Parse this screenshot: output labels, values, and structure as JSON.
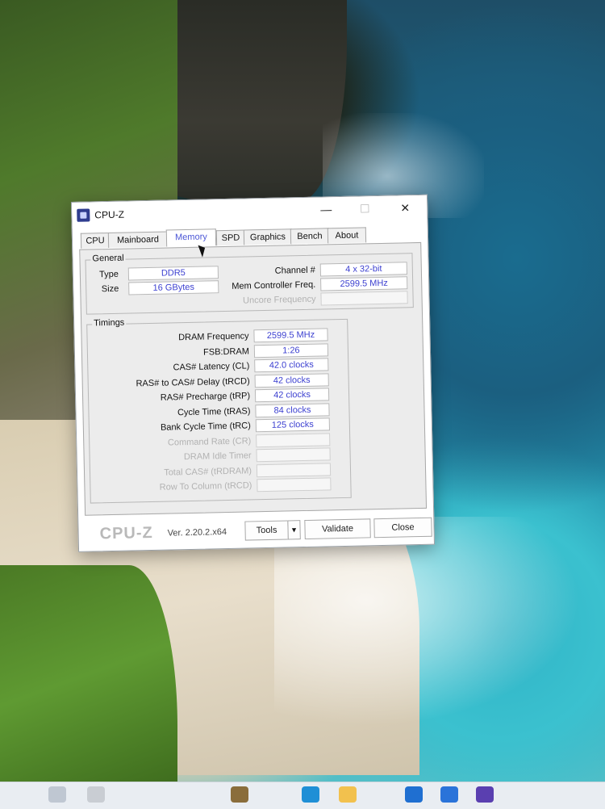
{
  "window": {
    "title": "CPU-Z",
    "minimize_glyph": "—",
    "maximize_glyph": "☐",
    "close_glyph": "✕"
  },
  "tabs": [
    {
      "label": "CPU",
      "active": false
    },
    {
      "label": "Mainboard",
      "active": false
    },
    {
      "label": "Memory",
      "active": true
    },
    {
      "label": "SPD",
      "active": false
    },
    {
      "label": "Graphics",
      "active": false
    },
    {
      "label": "Bench",
      "active": false
    },
    {
      "label": "About",
      "active": false
    }
  ],
  "general": {
    "title": "General",
    "type_label": "Type",
    "type_value": "DDR5",
    "size_label": "Size",
    "size_value": "16 GBytes",
    "channel_label": "Channel #",
    "channel_value": "4 x 32-bit",
    "mem_ctrl_label": "Mem Controller Freq.",
    "mem_ctrl_value": "2599.5 MHz",
    "uncore_label": "Uncore Frequency",
    "uncore_value": ""
  },
  "timings": {
    "title": "Timings",
    "rows": [
      {
        "label": "DRAM Frequency",
        "value": "2599.5 MHz",
        "enabled": true
      },
      {
        "label": "FSB:DRAM",
        "value": "1:26",
        "enabled": true
      },
      {
        "label": "CAS# Latency (CL)",
        "value": "42.0 clocks",
        "enabled": true
      },
      {
        "label": "RAS# to CAS# Delay (tRCD)",
        "value": "42 clocks",
        "enabled": true
      },
      {
        "label": "RAS# Precharge (tRP)",
        "value": "42 clocks",
        "enabled": true
      },
      {
        "label": "Cycle Time (tRAS)",
        "value": "84 clocks",
        "enabled": true
      },
      {
        "label": "Bank Cycle Time (tRC)",
        "value": "125 clocks",
        "enabled": true
      },
      {
        "label": "Command Rate (CR)",
        "value": "",
        "enabled": false
      },
      {
        "label": "DRAM Idle Timer",
        "value": "",
        "enabled": false
      },
      {
        "label": "Total CAS# (tRDRAM)",
        "value": "",
        "enabled": false
      },
      {
        "label": "Row To Column (tRCD)",
        "value": "",
        "enabled": false
      }
    ]
  },
  "footer": {
    "brand": "CPU-Z",
    "version": "Ver. 2.20.2.x64",
    "tools_label": "Tools",
    "validate_label": "Validate",
    "close_label": "Close"
  },
  "taskbar": {
    "icons": [
      "start-icon",
      "search-icon",
      "widgets-icon",
      "edge-icon",
      "file-explorer-icon",
      "store-icon",
      "outlook-icon",
      "cpu-z-taskbar-icon"
    ],
    "colors": [
      "#bfc7d2",
      "#c9cdd3",
      "#8a6d3b",
      "#1f8fd6",
      "#f2c14e",
      "#1f6fd1",
      "#2a73d9",
      "#5a3fb0"
    ]
  }
}
